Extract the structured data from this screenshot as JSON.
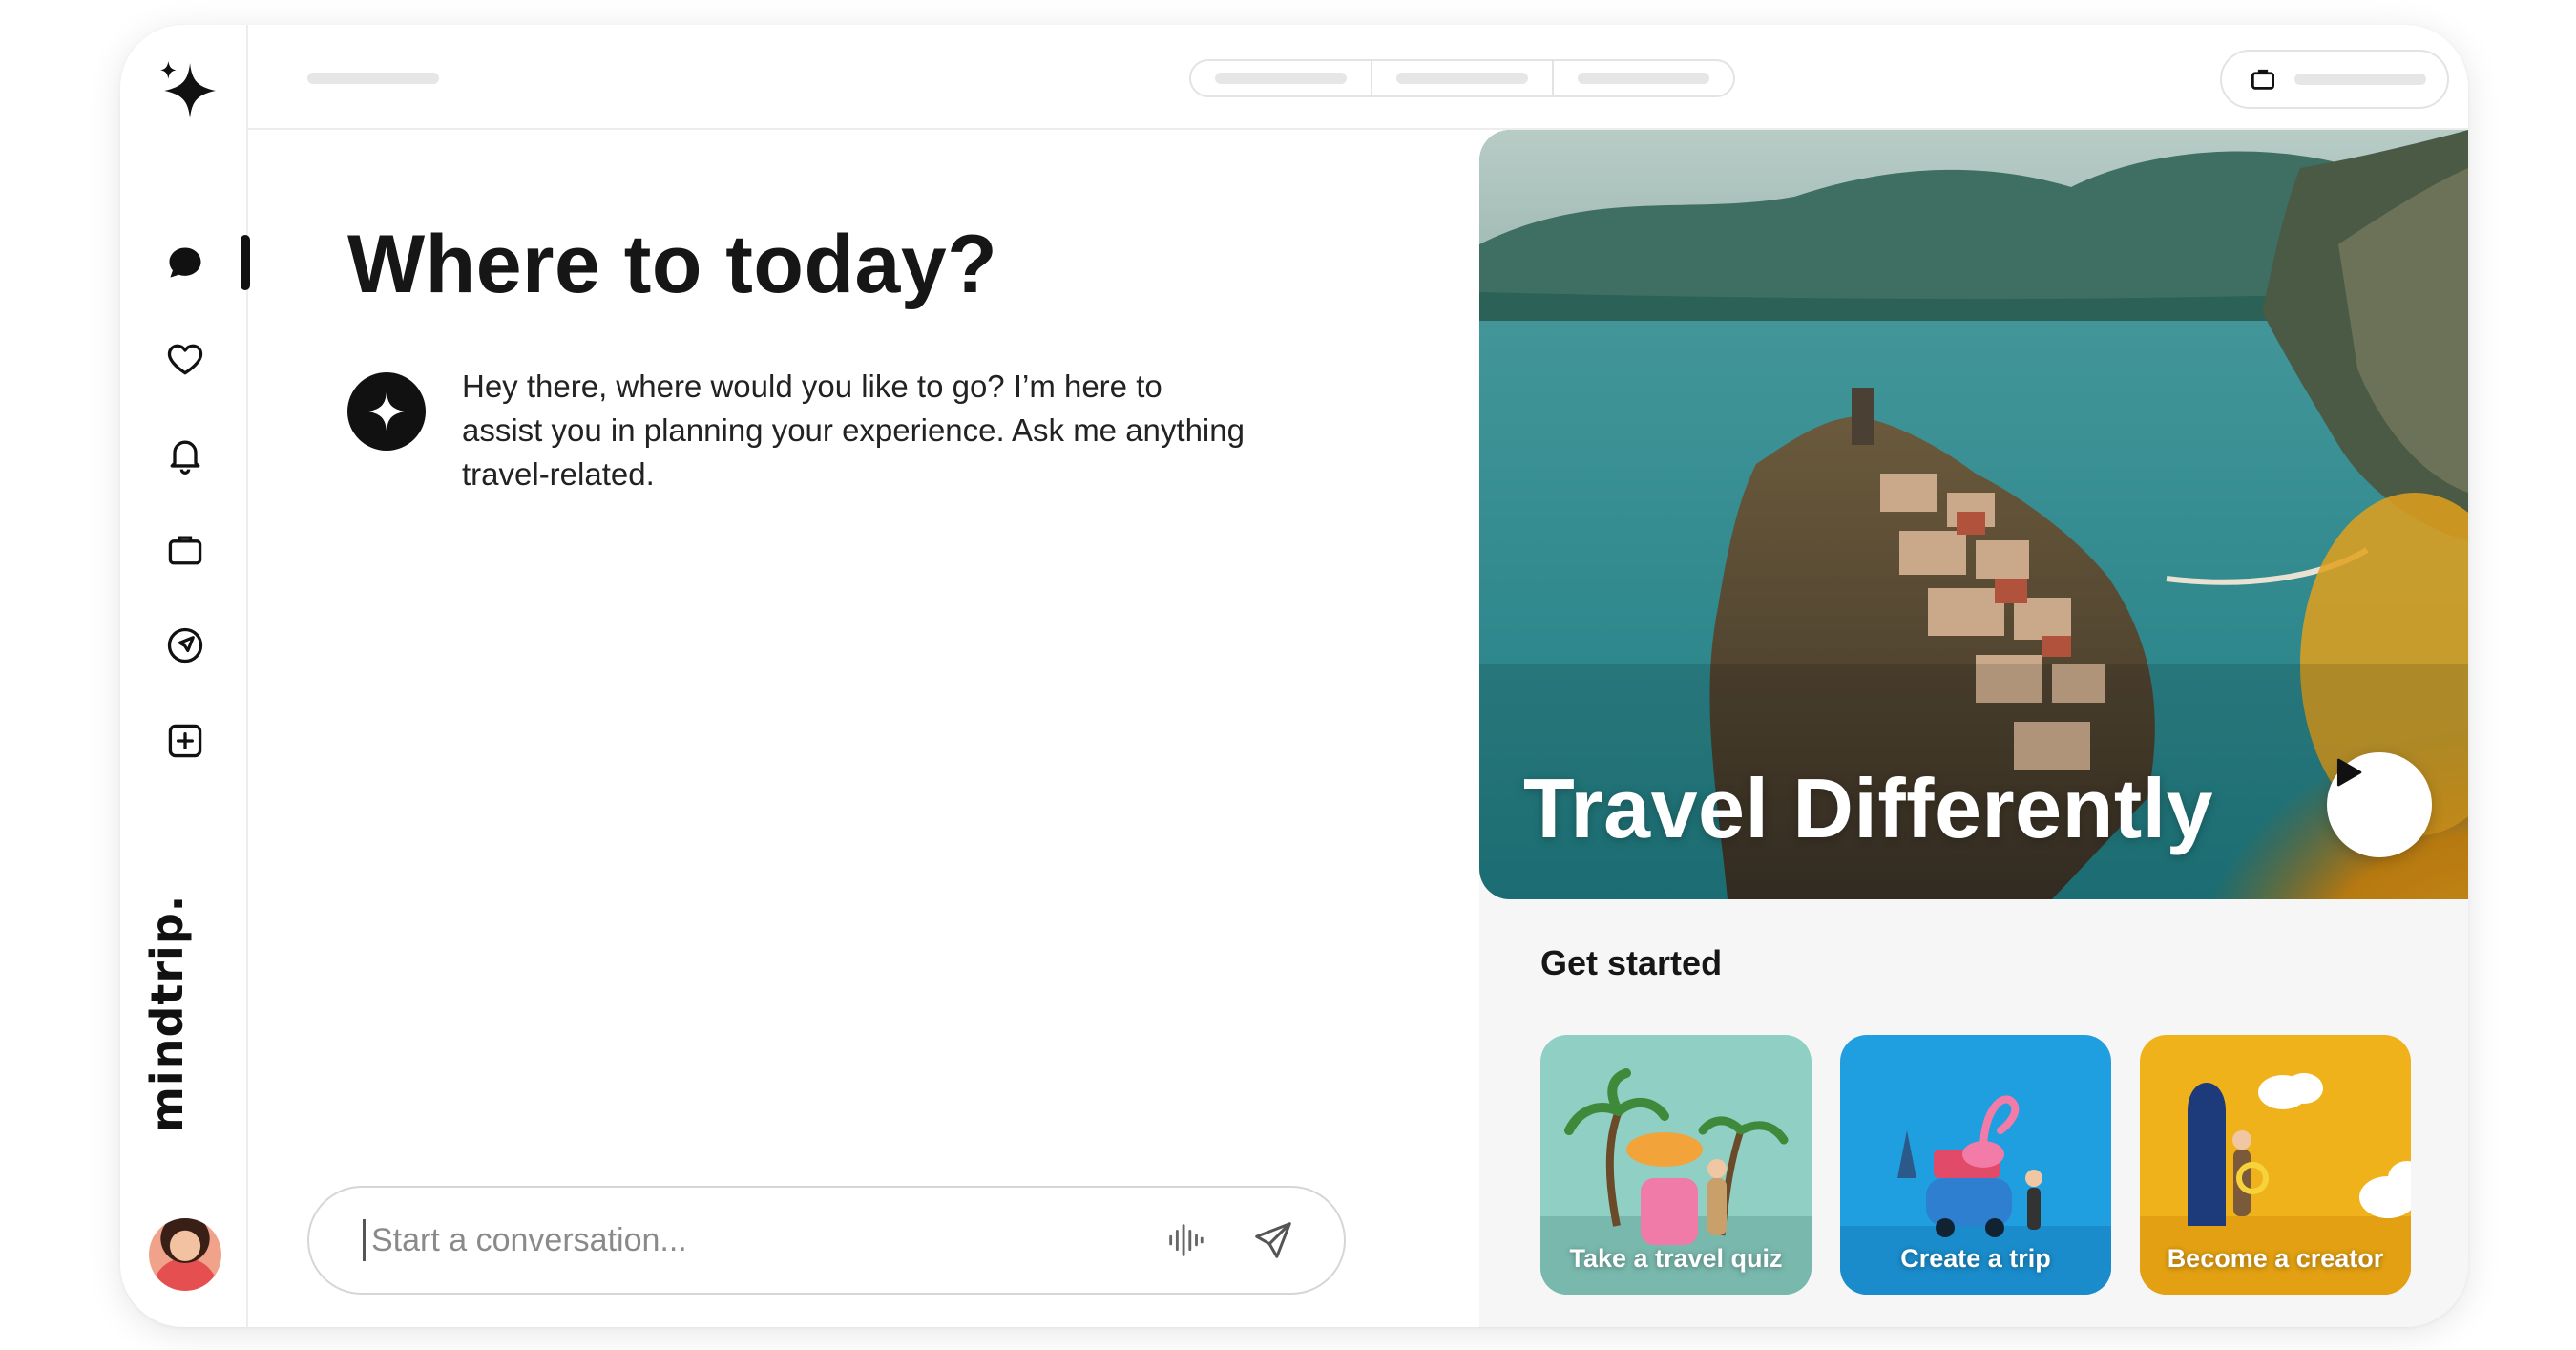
{
  "brand": {
    "name": "mindtrip."
  },
  "sidebar": {
    "items": [
      {
        "icon": "chat-icon"
      },
      {
        "icon": "heart-icon"
      },
      {
        "icon": "bell-icon"
      },
      {
        "icon": "briefcase-icon"
      },
      {
        "icon": "navigation-icon"
      },
      {
        "icon": "plus-square-icon"
      }
    ]
  },
  "main": {
    "headline": "Where to today?",
    "bot_message": "Hey there, where would you like to go? I’m here to assist you in planning your experience. Ask me anything travel-related."
  },
  "composer": {
    "placeholder": "Start a conversation...",
    "voice_icon": "voice-icon",
    "send_icon": "send-icon"
  },
  "hero": {
    "title": "Travel Differently",
    "play_icon": "play-icon"
  },
  "get_started": {
    "title": "Get started",
    "cards": [
      {
        "label": "Take a travel quiz"
      },
      {
        "label": "Create a trip"
      },
      {
        "label": "Become a creator"
      }
    ]
  },
  "colors": {
    "ink": "#111111",
    "border": "#e3e3e3",
    "panel_bg": "#f6f6f6",
    "quiz_card": "#8fcfc4",
    "trip_card": "#1f9fe0",
    "creator_card": "#f0b21a"
  }
}
